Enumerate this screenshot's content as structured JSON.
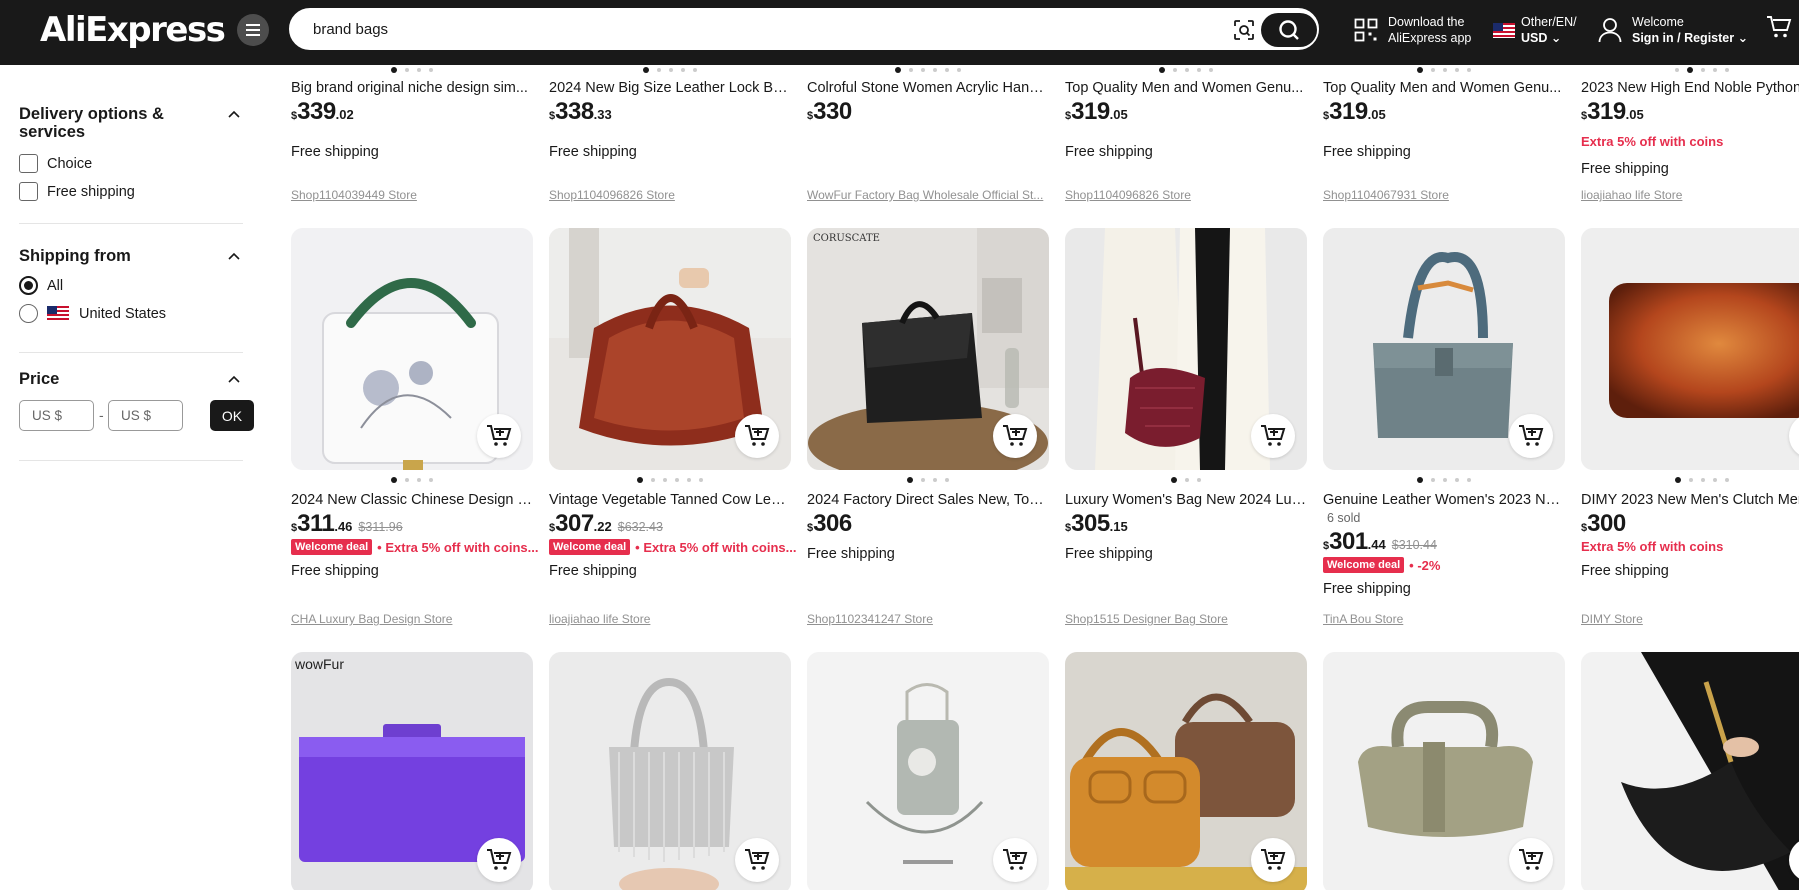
{
  "header": {
    "logo": "AliExpress",
    "search_value": "brand bags",
    "app_line1": "Download the",
    "app_line2": "AliExpress app",
    "locale_line1": "Other/EN/",
    "locale_line2": "USD",
    "welcome_line1": "Welcome",
    "welcome_line2": "Sign in / Register"
  },
  "sidebar": {
    "delivery": {
      "title": "Delivery options & services",
      "options": [
        "Choice",
        "Free shipping"
      ]
    },
    "shipping_from": {
      "title": "Shipping from",
      "options": [
        "All",
        "United States"
      ],
      "selected": "All"
    },
    "price": {
      "title": "Price",
      "min_placeholder": "US $",
      "max_placeholder": "US $",
      "separator": "-",
      "ok_label": "OK"
    }
  },
  "row1": [
    {
      "title": "Big brand original niche design sim...",
      "price_int": "339",
      "price_dec": ".02",
      "extra": "",
      "shipping": "Free shipping",
      "store": "Shop1104039449 Store"
    },
    {
      "title": "2024 New Big Size Leather Lock Bu...",
      "price_int": "338",
      "price_dec": ".33",
      "extra": "",
      "shipping": "Free shipping",
      "store": "Shop1104096826 Store"
    },
    {
      "title": "Colroful Stone Women Acrylic Hand...",
      "price_int": "330",
      "price_dec": "",
      "extra": "",
      "shipping": "",
      "store": "WowFur Factory Bag Wholesale Official St..."
    },
    {
      "title": "Top Quality Men and Women Genu...",
      "price_int": "319",
      "price_dec": ".05",
      "extra": "",
      "shipping": "Free shipping",
      "store": "Shop1104096826 Store"
    },
    {
      "title": "Top Quality Men and Women Genu...",
      "price_int": "319",
      "price_dec": ".05",
      "extra": "",
      "shipping": "Free shipping",
      "store": "Shop1104067931 Store"
    },
    {
      "title": "2023 New High End Noble Python P...",
      "price_int": "319",
      "price_dec": ".05",
      "extra": "Extra 5% off with coins",
      "shipping": "Free shipping",
      "store": "lioajiahao life Store"
    }
  ],
  "row2": [
    {
      "title": "2024 New Classic Chinese Design H...",
      "sold": "",
      "price_int": "311",
      "price_dec": ".46",
      "orig": "$311.96",
      "badge": "Welcome deal",
      "promo": "• Extra 5% off with coins...",
      "shipping": "Free shipping",
      "store": "CHA Luxury Bag Design Store"
    },
    {
      "title": "Vintage Vegetable Tanned Cow Leat...",
      "sold": "",
      "price_int": "307",
      "price_dec": ".22",
      "orig": "$632.43",
      "badge": "Welcome deal",
      "promo": "• Extra 5% off with coins...",
      "shipping": "Free shipping",
      "store": "lioajiahao life Store"
    },
    {
      "title": "2024 Factory Direct Sales New, Top ...",
      "sold": "",
      "price_int": "306",
      "price_dec": "",
      "orig": "",
      "badge": "",
      "promo": "",
      "shipping": "Free shipping",
      "store": "Shop1102341247 Store"
    },
    {
      "title": "Luxury Women's Bag New 2024 Lux...",
      "sold": "",
      "price_int": "305",
      "price_dec": ".15",
      "orig": "",
      "badge": "",
      "promo": "",
      "shipping": "Free shipping",
      "store": "Shop1515 Designer Bag Store"
    },
    {
      "title": "Genuine Leather Women's 2023 Ne...",
      "sold": "6 sold",
      "price_int": "301",
      "price_dec": ".44",
      "orig": "$310.44",
      "badge": "Welcome deal",
      "promo": "• -2%",
      "shipping": "Free shipping",
      "store": "TinA Bou Store"
    },
    {
      "title": "DIMY 2023 New Men's Clutch Men ...",
      "sold": "",
      "price_int": "300",
      "price_dec": "",
      "orig": "",
      "badge": "",
      "promo": "Extra 5% off with coins",
      "shipping": "Free shipping",
      "store": "DIMY Store"
    }
  ],
  "row3_images": [
    {
      "brand_text": "wowFur"
    },
    {
      "brand_text": ""
    },
    {
      "brand_text": ""
    },
    {
      "brand_text": ""
    },
    {
      "brand_text": ""
    },
    {
      "brand_text": ""
    }
  ],
  "row2_images": [
    {
      "brand_text": ""
    },
    {
      "brand_text": ""
    },
    {
      "brand_text": "CORUSCATE"
    },
    {
      "brand_text": ""
    },
    {
      "brand_text": ""
    },
    {
      "brand_text": ""
    }
  ],
  "currency_symbol": "$",
  "colors": {
    "header_bg": "#191919",
    "promo_red": "#e62e4d",
    "store_grey": "#919191"
  }
}
